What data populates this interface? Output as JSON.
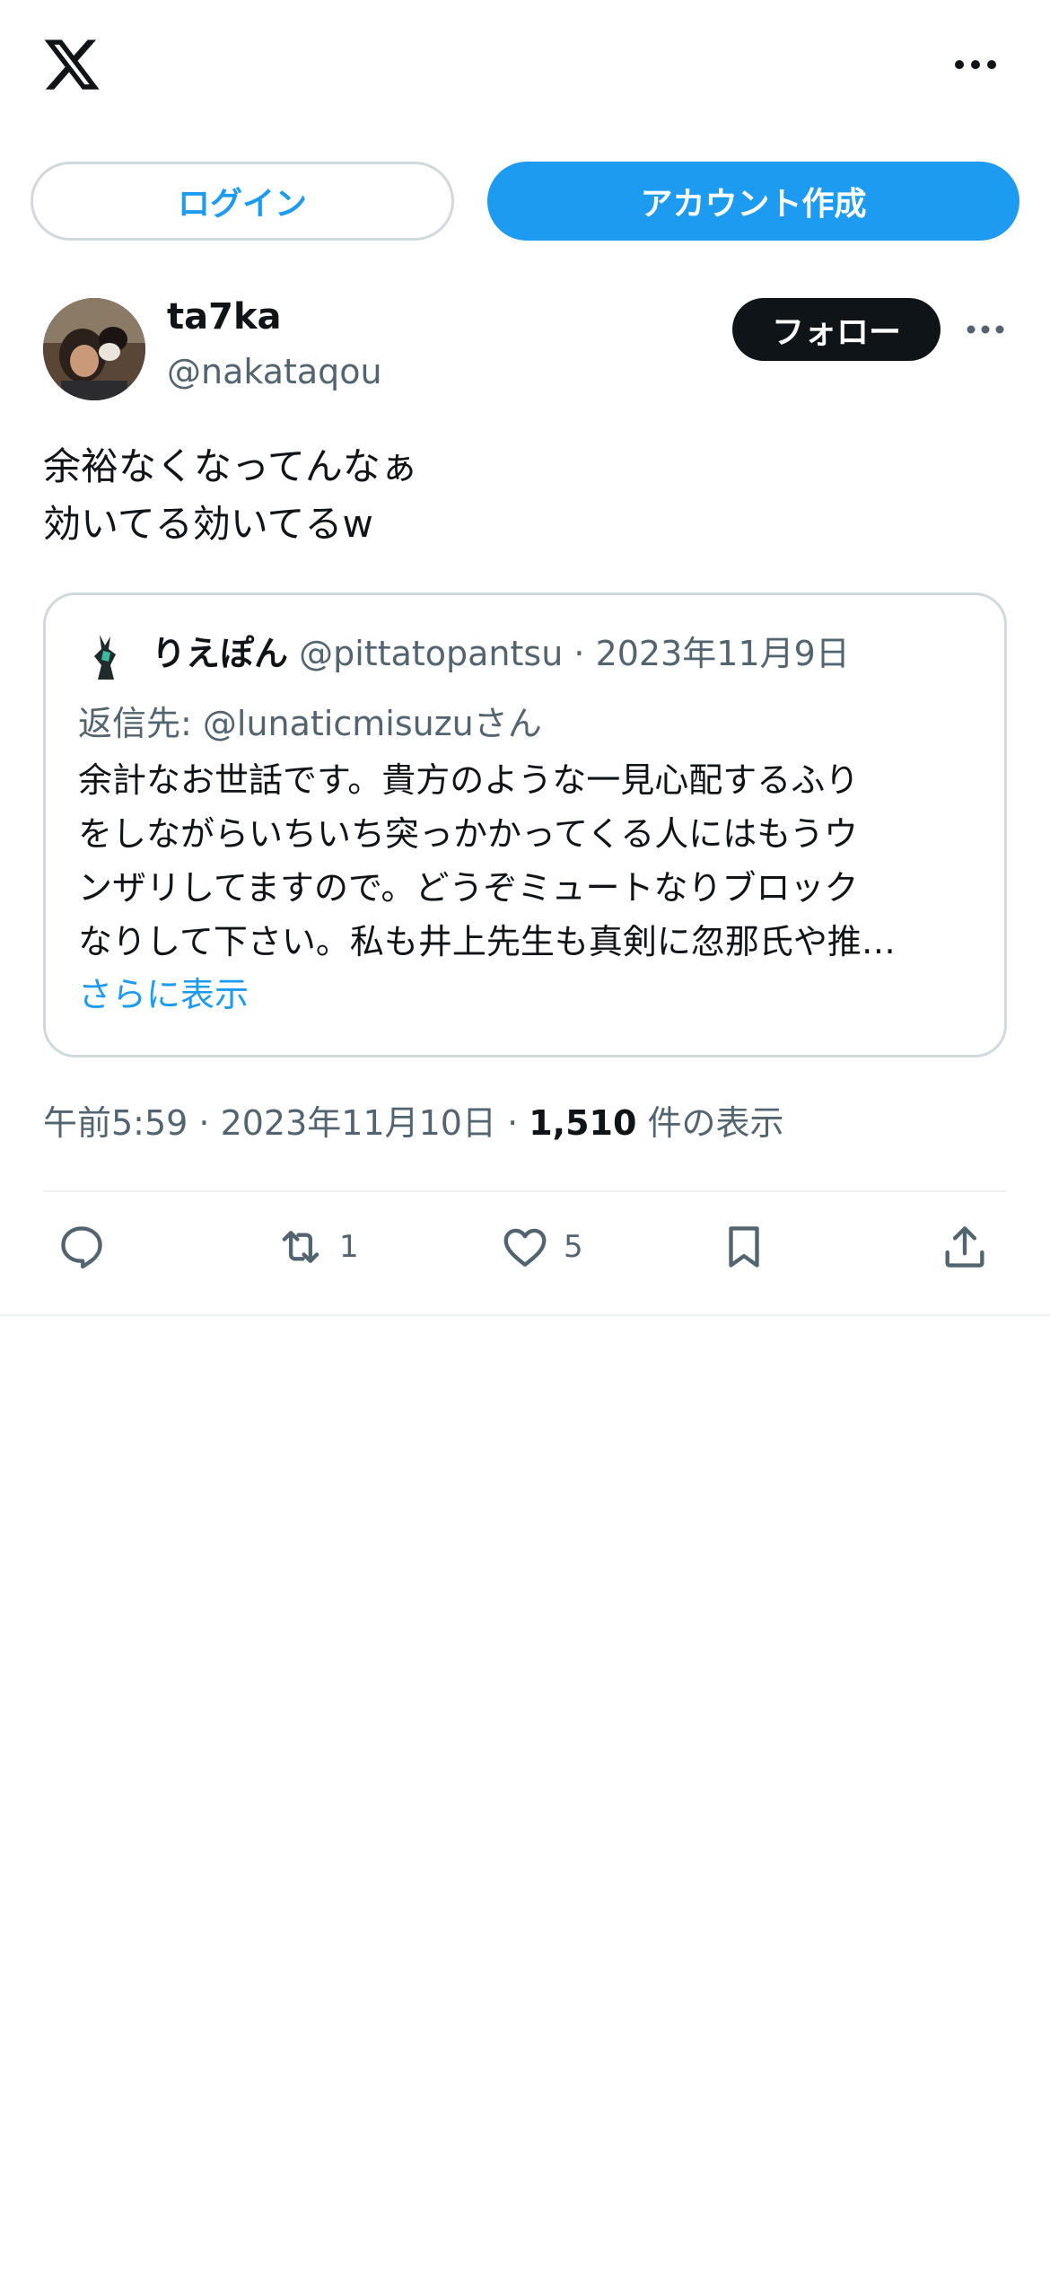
{
  "header": {
    "logo_icon": "x-logo-icon",
    "more_icon": "more-horizontal-icon"
  },
  "auth": {
    "login_label": "ログイン",
    "signup_label": "アカウント作成"
  },
  "tweet": {
    "display_name": "ta7ka",
    "handle": "@nakataqou",
    "follow_label": "フォロー",
    "text_lines": [
      "余裕なくなってんなぁ",
      "効いてる効いてるw"
    ],
    "quote": {
      "display_name": "りえぽん",
      "handle": "@pittatopantsu",
      "separator": "·",
      "date": "2023年11月9日",
      "reply_to": "返信先: @lunaticmisuzuさん",
      "body_lines": [
        "余計なお世話です。貴方のような一見心配するふり",
        "をしながらいちいち突っかかってくる人にはもうウ",
        "ンザリしてますので。どうぞミュートなりブロック",
        "なりして下さい。私も井上先生も真剣に忽那氏や推…"
      ],
      "show_more": "さらに表示"
    },
    "meta": {
      "time": "午前5:59 · 2023年11月10日 · ",
      "views": "1,510",
      "views_label": " 件の表示"
    },
    "actions": {
      "reply_icon": "reply-icon",
      "retweet_icon": "retweet-icon",
      "retweet_count": "1",
      "like_icon": "heart-icon",
      "like_count": "5",
      "bookmark_icon": "bookmark-icon",
      "share_icon": "share-icon"
    }
  },
  "colors": {
    "accent": "#1d9bf0",
    "text_primary": "#0f1419",
    "text_secondary": "#536471",
    "border": "#cfd9de"
  }
}
